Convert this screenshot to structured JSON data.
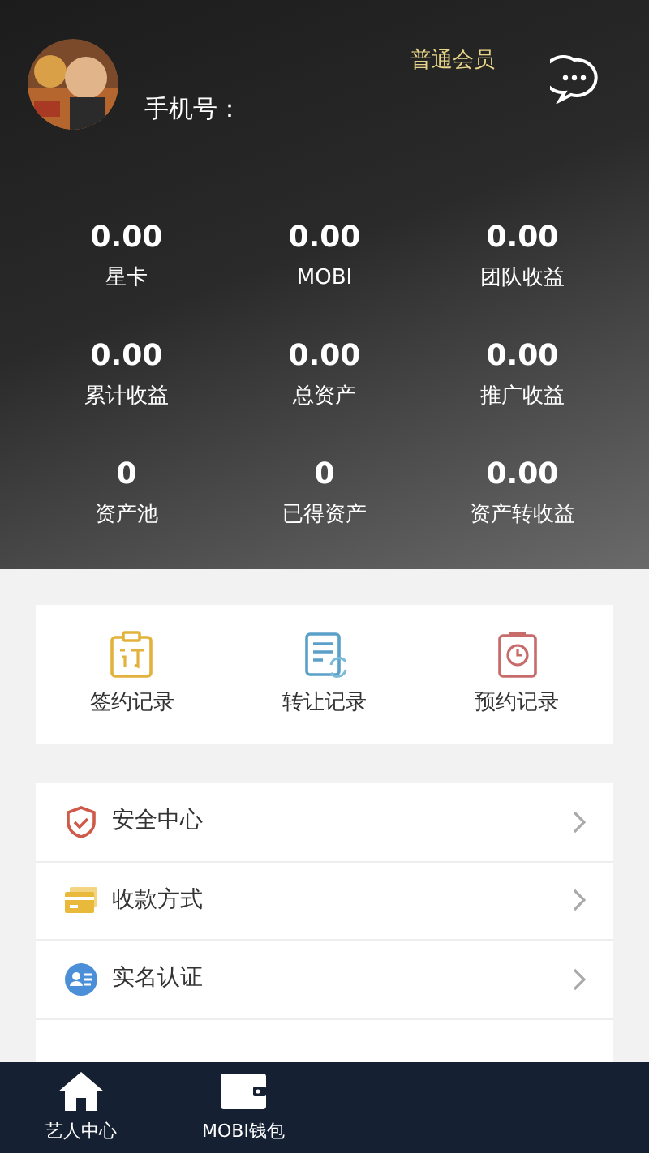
{
  "profile": {
    "member_level": "普通会员",
    "phone_label": "手机号："
  },
  "stats": [
    {
      "value": "0.00",
      "label": "星卡"
    },
    {
      "value": "0.00",
      "label": "MOBI"
    },
    {
      "value": "0.00",
      "label": "团队收益"
    },
    {
      "value": "0.00",
      "label": "累计收益"
    },
    {
      "value": "0.00",
      "label": "总资产"
    },
    {
      "value": "0.00",
      "label": "推广收益"
    },
    {
      "value": "0",
      "label": "资产池"
    },
    {
      "value": "0",
      "label": "已得资产"
    },
    {
      "value": "0.00",
      "label": "资产转收益"
    }
  ],
  "records": [
    {
      "kind": "contract",
      "label": "签约记录"
    },
    {
      "kind": "transfer",
      "label": "转让记录"
    },
    {
      "kind": "booking",
      "label": "预约记录"
    }
  ],
  "menu": [
    {
      "kind": "security",
      "label": "安全中心"
    },
    {
      "kind": "payment",
      "label": "收款方式"
    },
    {
      "kind": "identity",
      "label": "实名认证"
    }
  ],
  "bottom_nav": [
    {
      "kind": "home",
      "label": "艺人中心"
    },
    {
      "kind": "wallet",
      "label": "MOBI钱包"
    }
  ]
}
